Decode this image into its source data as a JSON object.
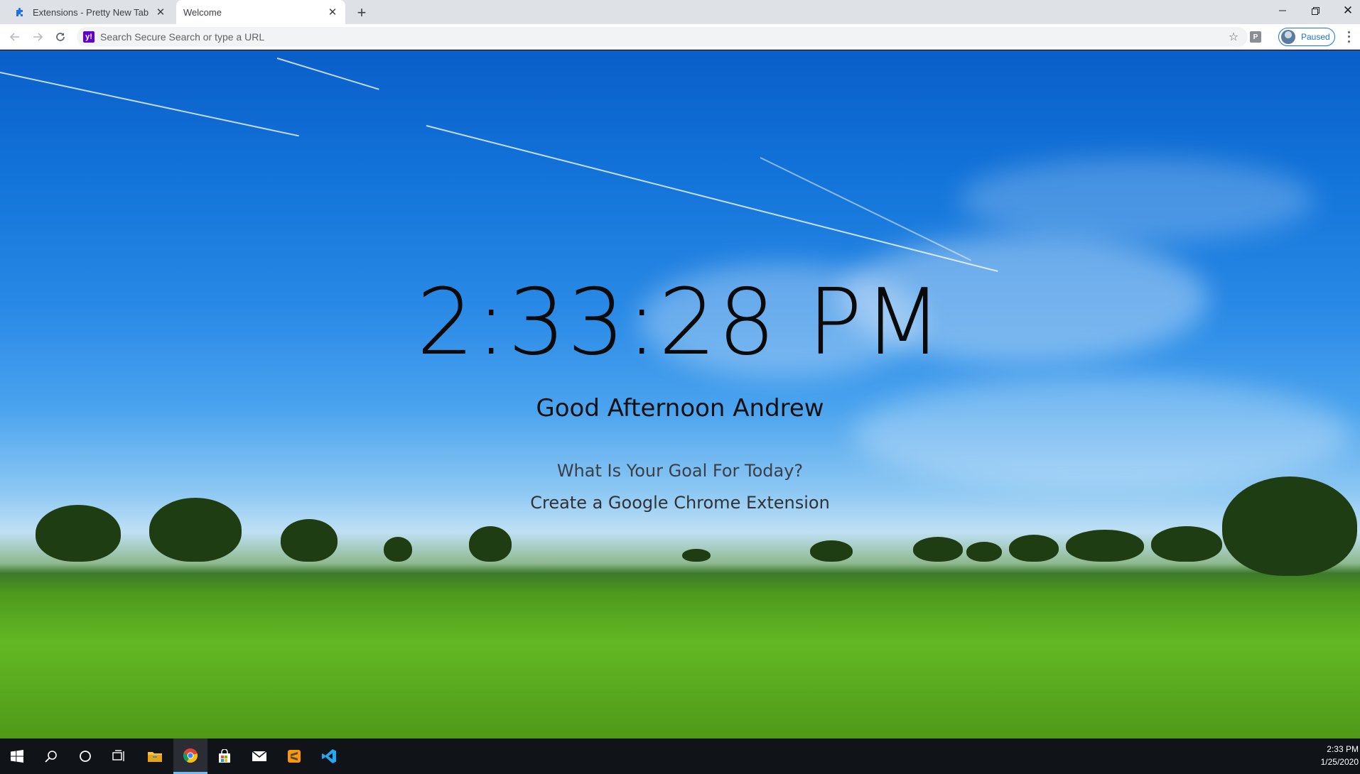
{
  "browser": {
    "tabs": [
      {
        "title": "Extensions - Pretty New Tab",
        "icon": "puzzle-icon",
        "active": false
      },
      {
        "title": "Welcome",
        "icon": "none",
        "active": true
      }
    ],
    "omnibox_placeholder": "Search Secure Search or type a URL",
    "extension_badge": "P",
    "profile_status": "Paused"
  },
  "page": {
    "time": "2:33:28 PM",
    "greeting": "Good Afternoon Andrew",
    "goal_question": "What Is Your Goal For Today?",
    "goal_answer": "Create a Google Chrome Extension"
  },
  "taskbar": {
    "apps": [
      "windows-start-icon",
      "search-icon",
      "cortana-icon",
      "task-view-icon",
      "file-explorer-icon",
      "chrome-icon",
      "store-icon",
      "mail-icon",
      "sublime-text-icon",
      "vscode-icon"
    ],
    "active_app": "chrome-icon",
    "time": "2:33 PM",
    "date": "1/25/2020"
  },
  "colors": {
    "accent": "#1a73e8",
    "yahoo_purple": "#6001d2",
    "taskbar": "#101318"
  }
}
